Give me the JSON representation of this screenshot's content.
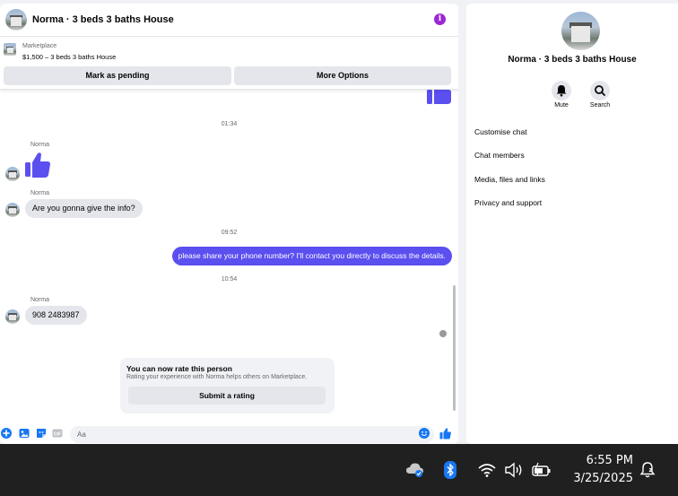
{
  "chat": {
    "title": "Norma · 3 beds 3 baths House",
    "marketplace_label": "Marketplace",
    "listing": "$1,500 – 3 beds 3 baths House",
    "btn_pending": "Mark as pending",
    "btn_more": "More Options"
  },
  "messages": {
    "ts1": "01:34",
    "sender1": "Norma",
    "sender2": "Norma",
    "msg_in_1": "Are you gonna give the info?",
    "ts2": "09:52",
    "msg_out_1": "please share your phone number? I'll contact you directly to discuss the details.",
    "ts3": "10:54",
    "sender3": "Norma",
    "msg_in_2": "908 2483987"
  },
  "rating": {
    "title": "You can now rate this person",
    "subtitle": "Rating your experience with Norma helps others on Marketplace.",
    "button": "Submit a rating"
  },
  "composer": {
    "placeholder": "Aa"
  },
  "info": {
    "name": "Norma · 3 beds 3 baths House",
    "mute": "Mute",
    "search": "Search",
    "items": [
      "Customise chat",
      "Chat members",
      "Media, files and links",
      "Privacy and support"
    ]
  },
  "taskbar": {
    "time": "6:55 PM",
    "date": "3/25/2025"
  },
  "colors": {
    "accent": "#5b4ff0",
    "info": "#9c27d6",
    "bubble_in": "#e4e6eb"
  },
  "icons": [
    "info-icon",
    "thumbs-up-icon",
    "plus-icon",
    "image-icon",
    "sticker-icon",
    "gif-icon",
    "emoji-icon",
    "bell-icon",
    "search-icon",
    "cloud-icon",
    "bluetooth-icon",
    "wifi-icon",
    "speaker-icon",
    "battery-icon",
    "notification-icon"
  ]
}
